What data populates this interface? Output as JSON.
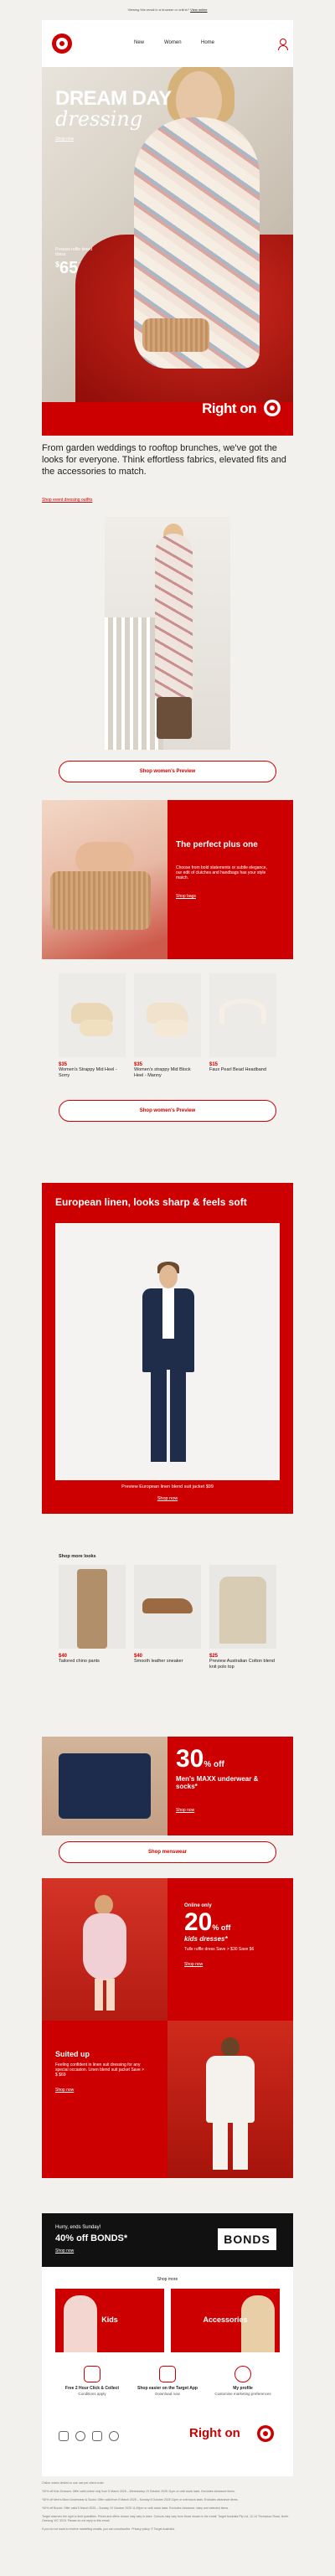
{
  "topbar": {
    "text": "Viewing this email in a browser or online?",
    "link": "View online"
  },
  "header": {
    "nav": [
      "New",
      "Women",
      "Home"
    ]
  },
  "hero": {
    "title": "DREAM DAY",
    "subtitle": "dressing",
    "shop": "Shop now",
    "price_label": "Preview ruffle tiered dress",
    "price": "65",
    "price_currency": "$",
    "brand": "Right on"
  },
  "intro": {
    "text": "From garden weddings to rooftop brunches, we've got the looks for everyone. Think effortless fabrics, elevated fits and the accessories to match.",
    "link": "Shop event dressing outfits"
  },
  "womens_btn": "Shop women's Preview",
  "perfect": {
    "title": "The perfect plus one",
    "text": "Choose from bold statements or subtle elegance, our edit of clutches and handbags has your style match.",
    "shop": "Shop bags"
  },
  "accessories": [
    {
      "price": "$35",
      "name": "Women's Strappy Mid Heel - Sorry"
    },
    {
      "price": "$35",
      "name": "Women's strappy Mid Block Heel - Manny"
    },
    {
      "price": "$15",
      "name": "Faux Pearl Bead Headband"
    }
  ],
  "womens_btn2": "Shop women's Preview",
  "linen": {
    "title": "European linen, looks sharp & feels soft",
    "caption": "Preview European linen blend suit jacket $99",
    "shop": "Shop now"
  },
  "more": {
    "label": "Shop more looks",
    "items": [
      {
        "price": "$40",
        "name": "Tailored chino pants"
      },
      {
        "price": "$40",
        "name": "Smooth leather sneaker"
      },
      {
        "price": "$25",
        "name": "Preview Australian Cotton blend knit polo top"
      }
    ]
  },
  "maxx": {
    "pct": "30",
    "off": "% off",
    "title": "Men's MAXX underwear & socks*",
    "shop": "Shop now"
  },
  "mens_btn": "Shop menswear",
  "kids": {
    "online": "Online only",
    "pct": "20",
    "off": "% off",
    "title": "kids dresses*",
    "sub": "Tulle ruffle dress Save > $30 Save $6",
    "shop1": "Shop now",
    "suit_title": "Suited up",
    "suit_text": "Feeling confident in linen suit dressing for any special occasion. Linen blend suit jacket Save > $ $69",
    "shop2": "Shop now"
  },
  "bonds": {
    "note": "Hurry, ends Sunday!",
    "offer": "40% off BONDS*",
    "shop": "Shop now",
    "logo": "BONDS"
  },
  "footer": {
    "shop_more": "Shop more",
    "tiles": [
      "Kids",
      "Accessories"
    ],
    "services": [
      {
        "title": "Free 2 Hour Click & Collect",
        "sub": "Conditions apply"
      },
      {
        "title": "Shop easier on the Target App",
        "sub": "Download now"
      },
      {
        "title": "My profile",
        "sub": "Customise marketing preferences"
      }
    ],
    "brand": "Right on"
  },
  "legal": [
    "Online orders limited to one use per client order.",
    "*20% off Kids Dresses: Offer valid online only from 5 March 2025 – Wednesday 19 October 2025 11pm or until stock lasts. Excludes clearance items.",
    "*30% off Men's Maxx Underwear & Socks: Offer valid from 5 March 2025 – Sunday 8 October 2025 11pm or until stock lasts. Excludes clearance items.",
    "*40% off Bonds: Offer valid 5 March 2025 – Sunday 19 October 2025 11:59pm or until stock lasts. Excludes clearance, baby and selected items.",
    "Target reserves the right to limit quantities. Prices and offers shown may vary in store. Colours may vary from those shown in the email. Target Australia Pty Ltd, 12-14 Thompson Road, North Geelong VIC 3215. Please do not reply to this email.",
    "If you do not want to receive marketing emails, you can unsubscribe. Privacy policy. © Target Australia."
  ],
  "colors": {
    "brand_red": "#cc0000",
    "bg": "#f3f1ed"
  }
}
